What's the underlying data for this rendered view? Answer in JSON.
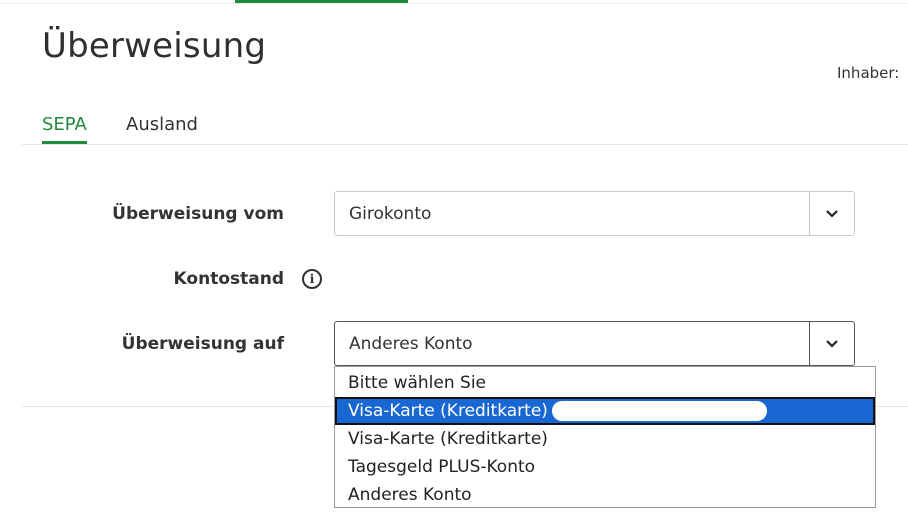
{
  "page": {
    "title": "Überweisung",
    "owner_label": "Inhaber:"
  },
  "tabs": [
    {
      "label": "SEPA",
      "active": true
    },
    {
      "label": "Ausland",
      "active": false
    }
  ],
  "form": {
    "from_label": "Überweisung vom",
    "from_value": "Girokonto",
    "balance_label": "Kontostand",
    "to_label": "Überweisung auf",
    "to_value": "Anderes Konto"
  },
  "dropdown": {
    "options": [
      "Bitte wählen Sie",
      "Visa-Karte (Kreditkarte)",
      "Visa-Karte (Kreditkarte)",
      "Tagesgeld PLUS-Konto",
      "Anderes Konto"
    ],
    "highlighted_index": 1
  },
  "colors": {
    "accent": "#1f8a3c",
    "highlight": "#1967d2"
  },
  "icons": {
    "info": "info-icon",
    "chevron": "chevron-down-icon"
  }
}
